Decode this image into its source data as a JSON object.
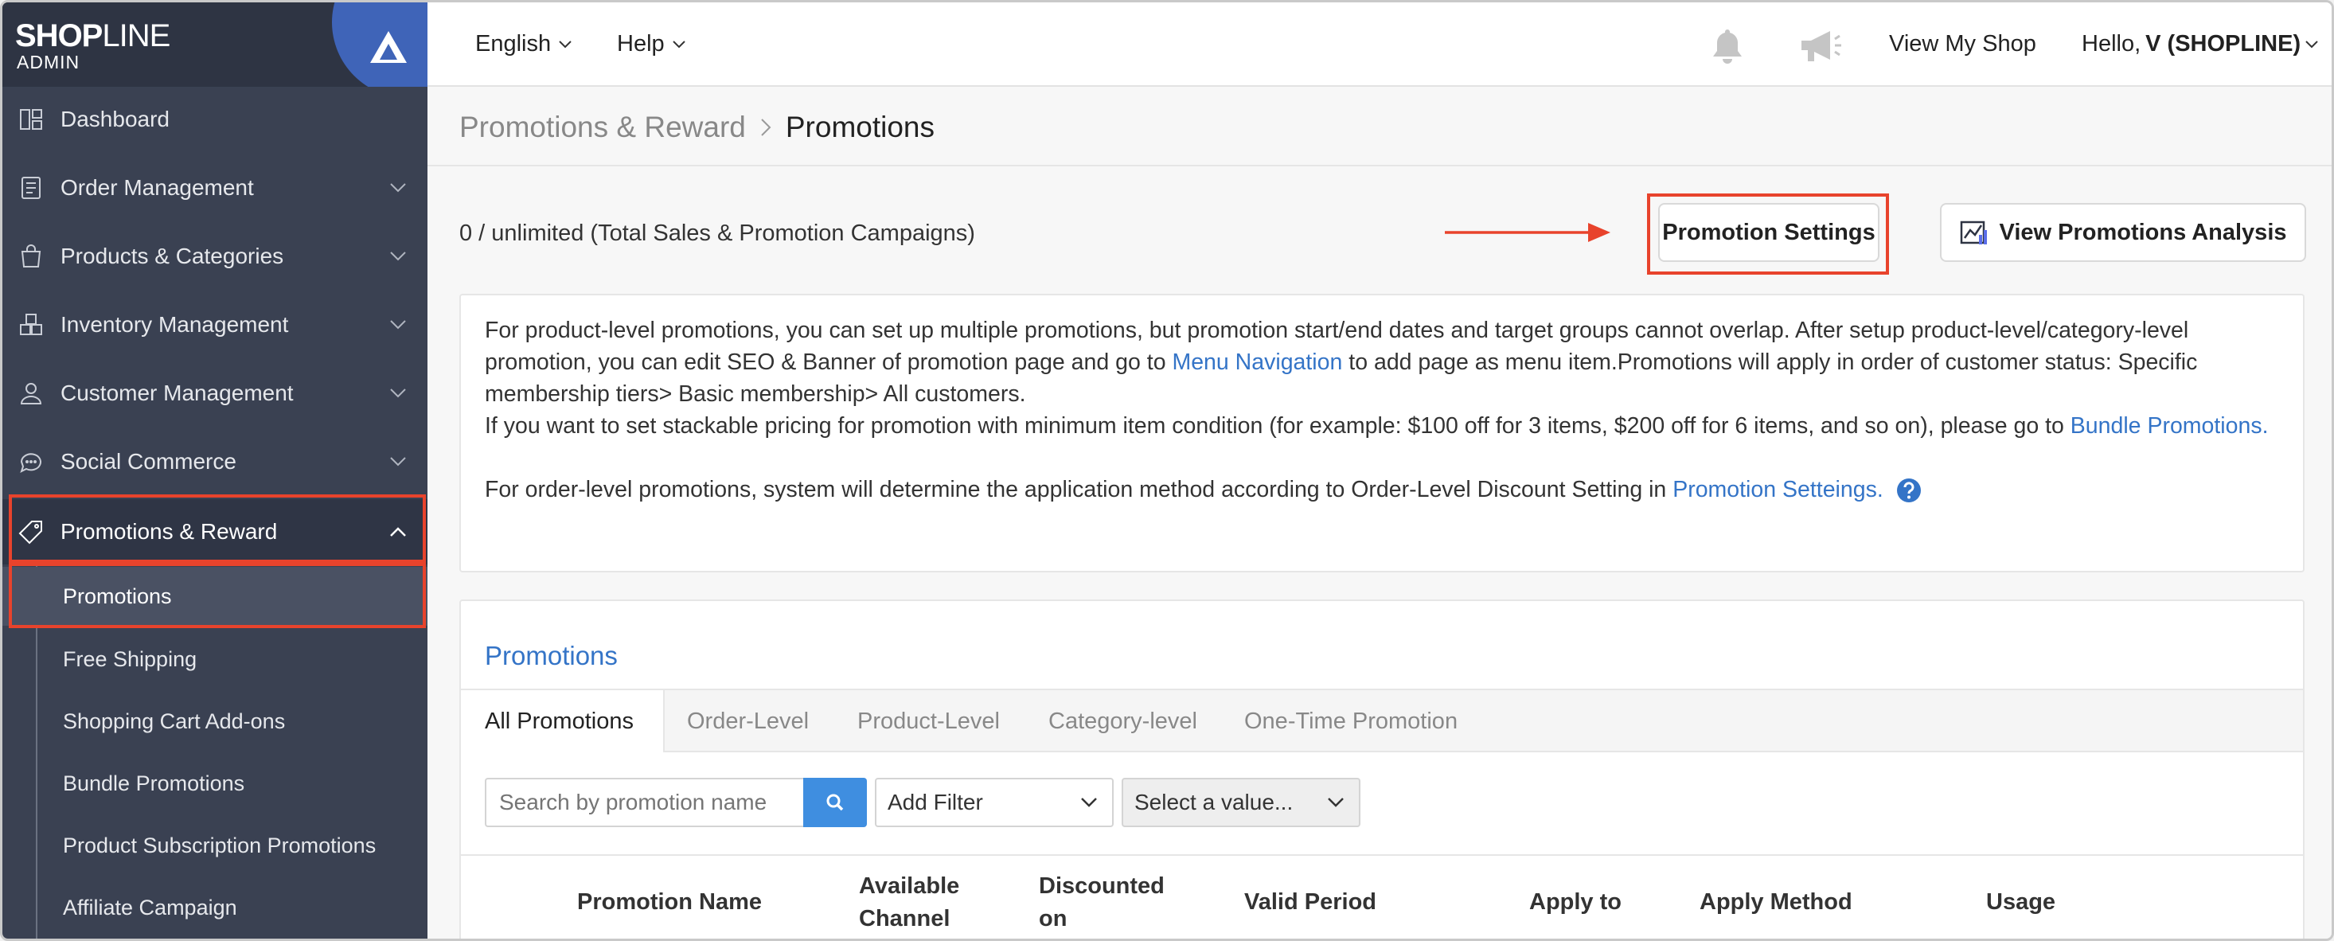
{
  "logo": {
    "brand_bold": "SHOP",
    "brand_thin": "LINE",
    "sub": "ADMIN"
  },
  "sidebar": {
    "items": [
      {
        "label": "Dashboard",
        "icon": "dashboard-icon"
      },
      {
        "label": "Order Management",
        "icon": "order-icon"
      },
      {
        "label": "Products & Categories",
        "icon": "shopping-bag-icon"
      },
      {
        "label": "Inventory Management",
        "icon": "inventory-icon"
      },
      {
        "label": "Customer Management",
        "icon": "customer-icon"
      },
      {
        "label": "Social Commerce",
        "icon": "chat-icon"
      },
      {
        "label": "Promotions & Reward",
        "icon": "tag-icon"
      }
    ],
    "sub_items": [
      {
        "label": "Promotions"
      },
      {
        "label": "Free Shipping"
      },
      {
        "label": "Shopping Cart Add-ons"
      },
      {
        "label": "Bundle Promotions"
      },
      {
        "label": "Product Subscription Promotions"
      },
      {
        "label": "Affiliate Campaign"
      }
    ]
  },
  "topbar": {
    "language": "English",
    "help": "Help",
    "view_shop": "View My Shop",
    "greeting": "Hello, ",
    "user": "V (SHOPLINE)"
  },
  "breadcrumb": {
    "parent": "Promotions & Reward",
    "current": "Promotions"
  },
  "count_text": "0 / unlimited (Total Sales & Promotion Campaigns)",
  "buttons": {
    "settings": "Promotion Settings",
    "analysis": "View Promotions Analysis"
  },
  "info": {
    "p1_a": "For product-level promotions, you can set up multiple promotions, but promotion start/end dates and target groups cannot overlap. After setup product-level/category-level promotion, you can edit SEO & Banner of promotion page and go to ",
    "p1_link": "Menu Navigation",
    "p1_b": " to add page as menu item.Promotions will apply in order of customer status: Specific membership tiers> Basic membership> All customers.",
    "p2_a": "If you want to set stackable pricing for promotion with minimum item condition (for example: $100 off for 3 items, $200 off for 6 items, and so on), please go to ",
    "p2_link": "Bundle Promotions.",
    "p3_a": "For order-level promotions, system will determine the application method according to Order-Level Discount Setting in ",
    "p3_link": "Promotion Setteings."
  },
  "promotions": {
    "title": "Promotions",
    "tabs": [
      "All Promotions",
      "Order-Level",
      "Product-Level",
      "Category-level",
      "One-Time Promotion"
    ],
    "search_placeholder": "Search by promotion name",
    "filter": "Add Filter",
    "value": "Select a value...",
    "columns": [
      "Promotion Name",
      "Available Channel",
      "Discounted on",
      "Valid Period",
      "Apply to",
      "Apply Method",
      "Usage"
    ]
  },
  "colors": {
    "sidebar": "#3a4152",
    "accent": "#3474c7",
    "highlight": "#e8432c"
  }
}
